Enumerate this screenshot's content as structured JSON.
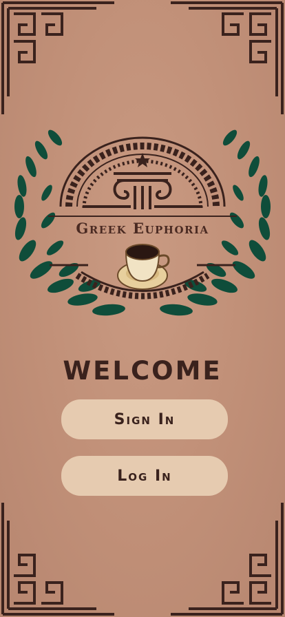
{
  "app": {
    "name": "Greek Euphoria"
  },
  "welcome": {
    "title": "WELCOME"
  },
  "actions": {
    "sign_in": "Sign In",
    "log_in": "Log In"
  },
  "colors": {
    "background": "#c08f77",
    "accent_dark": "#3a221d",
    "leaf_green": "#0f4d3a",
    "button_fill": "#e6cbb0"
  },
  "icons": [
    "greek-key-corner-icon",
    "laurel-wreath-icon",
    "greek-column-icon",
    "coffee-cup-icon",
    "star-icon"
  ]
}
